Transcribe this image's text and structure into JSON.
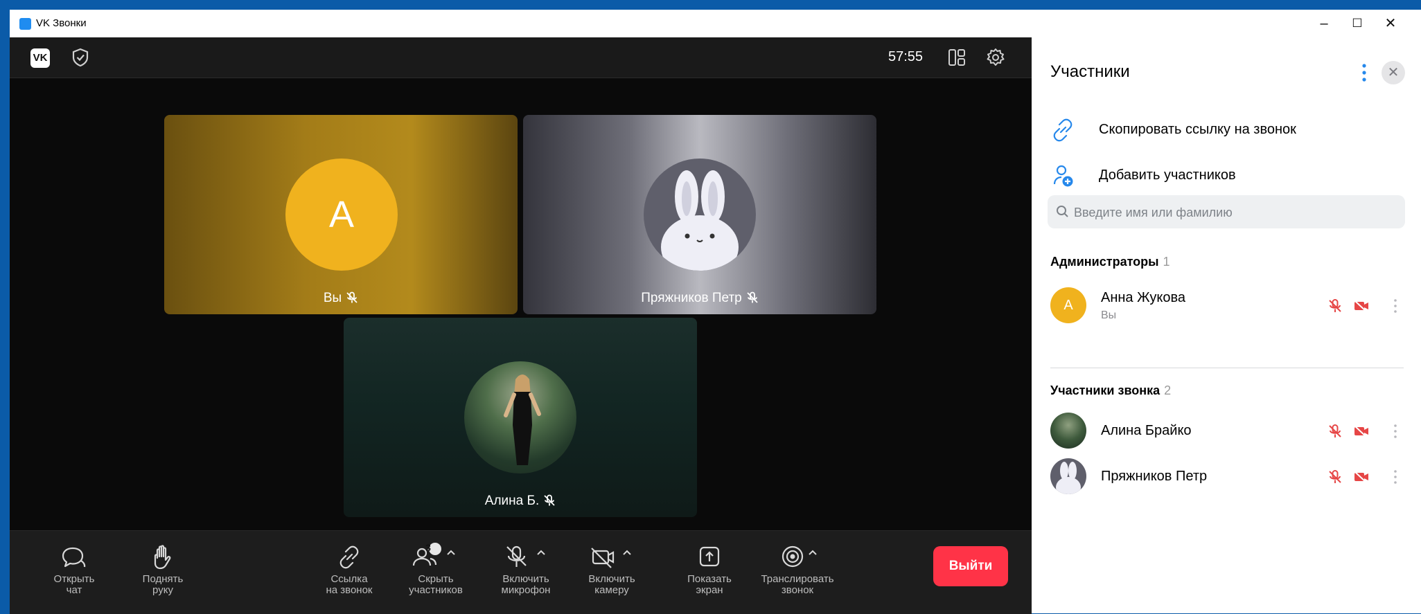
{
  "window": {
    "title": "VK Звонки",
    "minimize": "–",
    "maximize": "☐",
    "close": "✕"
  },
  "topbar": {
    "logo": "VK",
    "timer": "57:55",
    "icons": [
      "shield-icon",
      "layout-icon",
      "gear-icon"
    ]
  },
  "tiles": [
    {
      "avatar_letter": "A",
      "caption": "Вы",
      "bg_color": "#a37c18"
    },
    {
      "caption": "Пряжников Петр",
      "bg_color": "#6e6e78"
    },
    {
      "caption": "Алина Б.",
      "bg_color": "#122522"
    }
  ],
  "toolbar": {
    "open_chat": "Открыть\nчат",
    "raise_hand": "Поднять\nруку",
    "call_link": "Ссылка\nна звонок",
    "hide_participants": "Скрыть\nучастников",
    "participants_badge": "3",
    "enable_mic": "Включить\nмикрофон",
    "enable_camera": "Включить\nкамеру",
    "share_screen": "Показать\nэкран",
    "broadcast": "Транслировать\nзвонок",
    "exit": "Выйти",
    "exit_color": "#ff3347"
  },
  "panel": {
    "title": "Участники",
    "copy_link": "Скопировать ссылку на звонок",
    "add_participants": "Добавить участников",
    "search_placeholder": "Введите имя или фамилию",
    "admins": {
      "label": "Администраторы",
      "count": "1"
    },
    "admin_rows": [
      {
        "initial": "A",
        "name": "Анна Жукова",
        "sub": "Вы"
      }
    ],
    "members": {
      "label": "Участники звонка",
      "count": "2"
    },
    "member_rows": [
      {
        "name": "Алина Брайко"
      },
      {
        "name": "Пряжников Петр"
      }
    ],
    "accent_color": "#2688eb",
    "muted_color": "#e64646"
  }
}
